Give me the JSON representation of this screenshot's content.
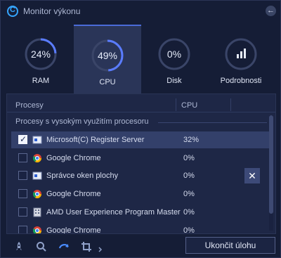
{
  "app": {
    "title": "Monitor výkonu",
    "logo_icon": "logo-icon",
    "back_icon": "back-arrow-icon"
  },
  "tabs": [
    {
      "key": "ram",
      "value": "24%",
      "label": "RAM",
      "level": 0.24
    },
    {
      "key": "cpu",
      "value": "49%",
      "label": "CPU",
      "level": 0.49,
      "active": true
    },
    {
      "key": "disk",
      "value": "0%",
      "label": "Disk",
      "level": 0
    },
    {
      "key": "details",
      "label": "Podrobnosti",
      "icon": "bar-chart-icon"
    }
  ],
  "table": {
    "headers": {
      "name": "Procesy",
      "cpu": "CPU"
    },
    "group_label": "Procesy s vysokým využitím procesoru",
    "rows": [
      {
        "name": "Microsoft(C) Register Server",
        "cpu": "32%",
        "icon": "window-icon",
        "checked": true,
        "selected": true
      },
      {
        "name": "Google Chrome",
        "cpu": "0%",
        "icon": "chrome-icon"
      },
      {
        "name": "Správce oken plochy",
        "cpu": "0%",
        "icon": "window-icon",
        "hover_close": true
      },
      {
        "name": "Google Chrome",
        "cpu": "0%",
        "icon": "chrome-icon"
      },
      {
        "name": "AMD User Experience Program Master",
        "cpu": "0%",
        "icon": "building-icon"
      },
      {
        "name": "Google Chrome",
        "cpu": "0%",
        "icon": "chrome-icon"
      }
    ],
    "end_x_label": "✕"
  },
  "bottom": {
    "end_task_label": "Ukončit úlohu",
    "icons": [
      "rocket-icon",
      "search-icon",
      "refresh-icon",
      "crop-icon",
      "chevron-right-icon"
    ]
  },
  "colors": {
    "accent": "#4a6bd8",
    "ring_track": "#3a4568",
    "ring_fill": "#5a7cff"
  }
}
